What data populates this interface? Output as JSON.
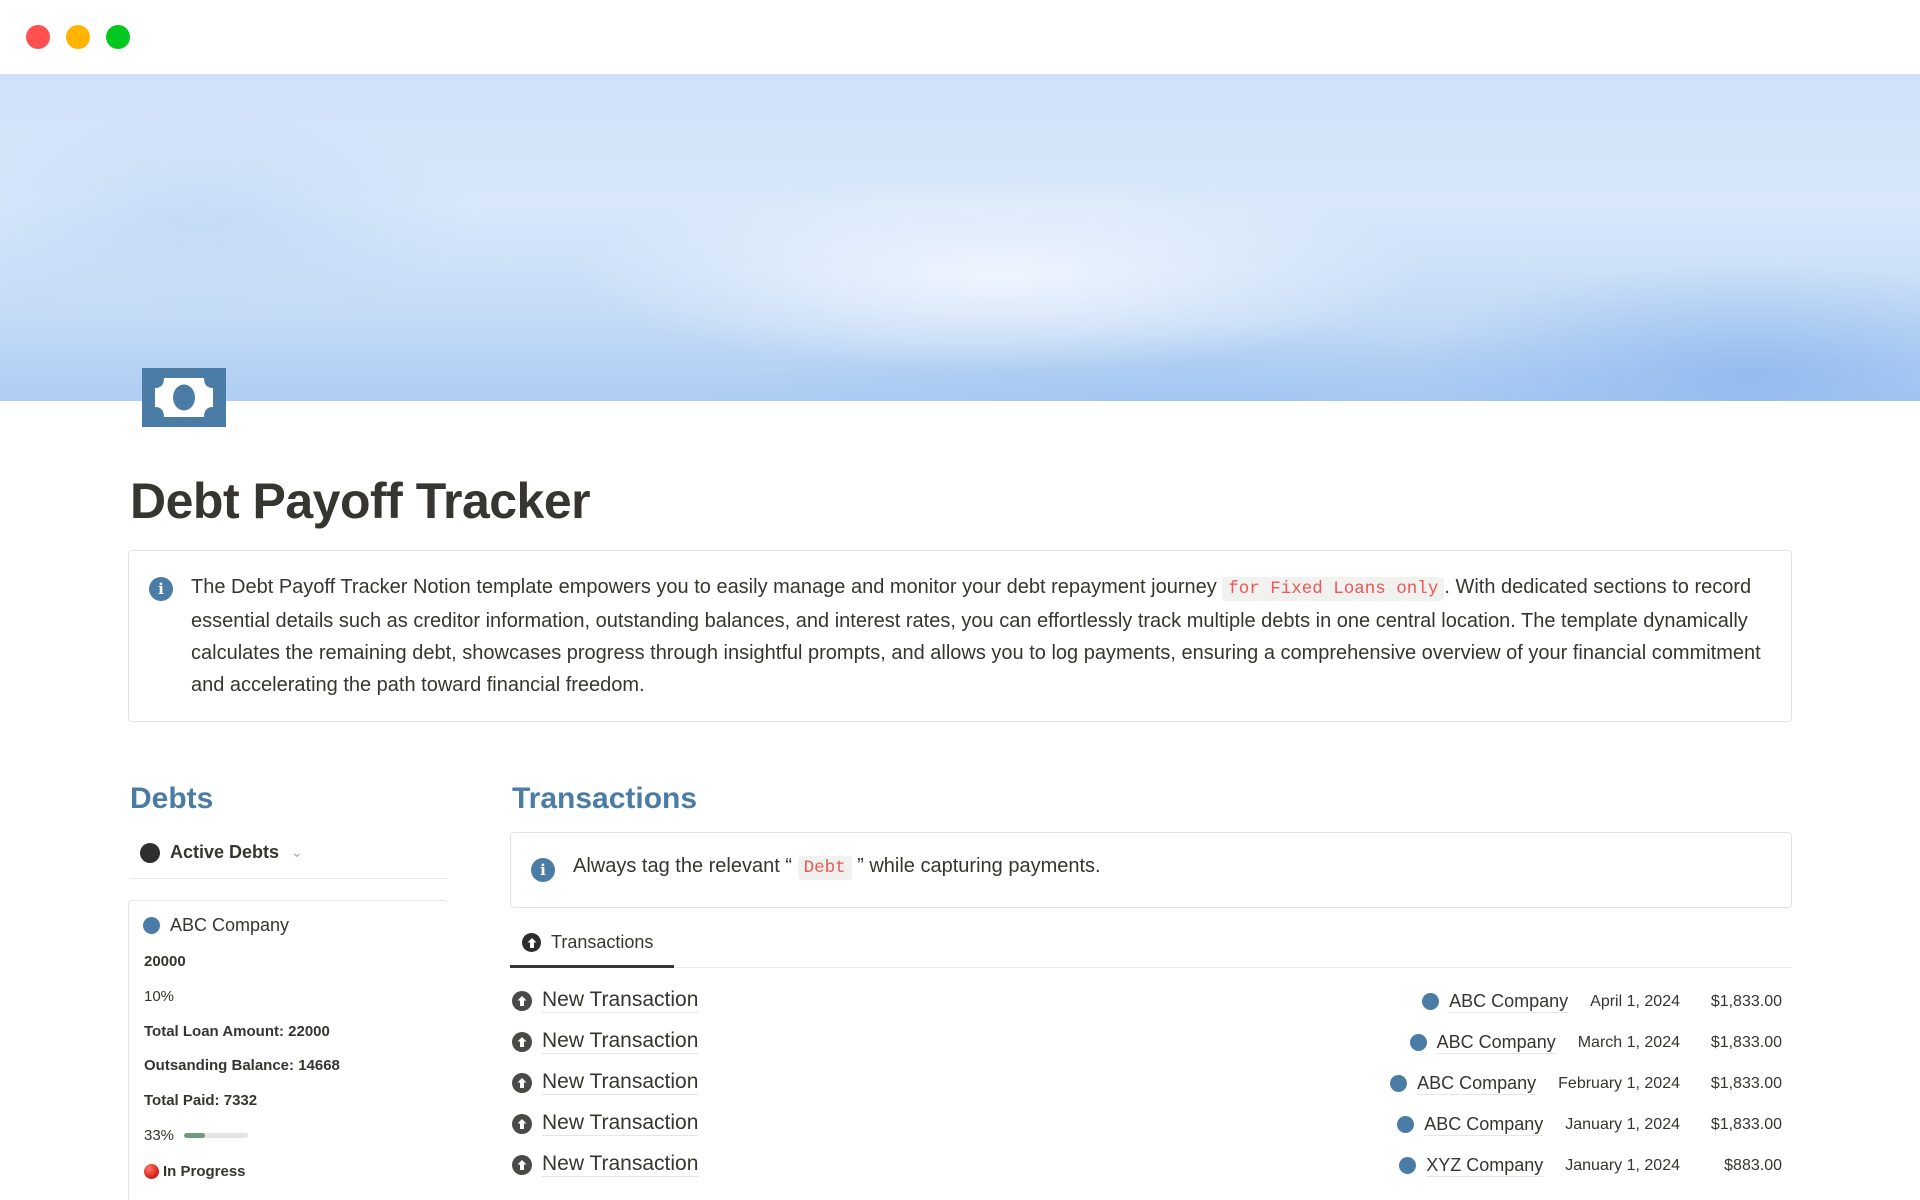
{
  "window": {
    "controls": [
      "close",
      "minimize",
      "maximize"
    ]
  },
  "page": {
    "icon": "banknote-icon",
    "title": "Debt Payoff Tracker",
    "intro": {
      "icon": "info-icon",
      "text_before": "The Debt Payoff Tracker Notion template empowers you to easily manage and monitor your debt repayment journey ",
      "code": "for Fixed Loans only",
      "text_after": ". With dedicated sections to record essential details such as creditor information, outstanding balances, and interest rates, you can effortlessly track multiple debts in one central location. The template dynamically calculates the remaining debt, showcases progress through insightful prompts, and allows you to log payments, ensuring a comprehensive overview of your financial commitment and accelerating the path toward financial freedom."
    }
  },
  "debts": {
    "heading": "Debts",
    "view": {
      "label": "Active Debts"
    },
    "cards": [
      {
        "name": "ABC Company",
        "principal": "20000",
        "interest_rate": "10%",
        "total_loan": "Total Loan Amount: 22000",
        "outstanding": "Outsanding Balance: 14668",
        "total_paid": "Total Paid: 7332",
        "progress_label": "33%",
        "progress": 0.33,
        "status": "In Progress"
      }
    ]
  },
  "transactions": {
    "heading": "Transactions",
    "tip": {
      "text_before": "Always tag the relevant “ ",
      "code": "Debt",
      "text_after": " ” while capturing payments."
    },
    "tab_label": "Transactions",
    "rows": [
      {
        "name": "New Transaction",
        "company": "ABC Company",
        "date": "April 1, 2024",
        "amount": "$1,833.00"
      },
      {
        "name": "New Transaction",
        "company": "ABC Company",
        "date": "March 1, 2024",
        "amount": "$1,833.00"
      },
      {
        "name": "New Transaction",
        "company": "ABC Company",
        "date": "February 1, 2024",
        "amount": "$1,833.00"
      },
      {
        "name": "New Transaction",
        "company": "ABC Company",
        "date": "January 1, 2024",
        "amount": "$1,833.00"
      },
      {
        "name": "New Transaction",
        "company": "XYZ Company",
        "date": "January 1, 2024",
        "amount": "$883.00"
      }
    ]
  },
  "colors": {
    "accent": "#4a7ca6",
    "code_text": "#eb5757",
    "progress_fill": "#6c9b7d",
    "status_red": "#d8261c"
  }
}
